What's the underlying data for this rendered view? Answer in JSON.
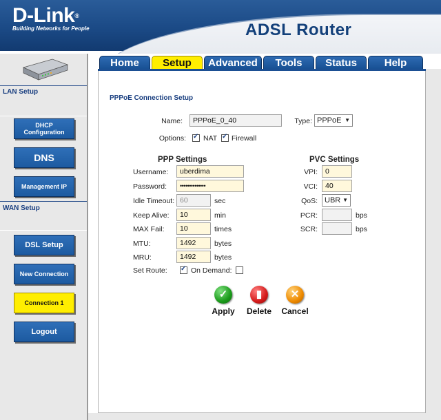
{
  "header": {
    "brand": "D-Link",
    "tagline": "Building Networks for People",
    "product": "ADSL Router"
  },
  "tabs": [
    {
      "label": "Home",
      "active": false
    },
    {
      "label": "Setup",
      "active": true
    },
    {
      "label": "Advanced",
      "active": false
    },
    {
      "label": "Tools",
      "active": false
    },
    {
      "label": "Status",
      "active": false
    },
    {
      "label": "Help",
      "active": false
    }
  ],
  "sidebar": {
    "lan_heading": "LAN Setup",
    "wan_heading": "WAN Setup",
    "buttons": {
      "dhcp": "DHCP Configuration",
      "dns": "DNS",
      "mgmt": "Management IP",
      "dsl": "DSL Setup",
      "newconn": "New Connection",
      "conn1": "Connection 1",
      "logout": "Logout"
    }
  },
  "form": {
    "title": "PPPoE Connection Setup",
    "name_label": "Name:",
    "name_value": "PPPoE_0_40",
    "type_label": "Type:",
    "type_value": "PPPoE",
    "options_label": "Options:",
    "nat_label": "NAT",
    "nat_checked": true,
    "firewall_label": "Firewall",
    "firewall_checked": true,
    "ppp": {
      "title": "PPP Settings",
      "username_label": "Username:",
      "username_value": "uberdima",
      "password_label": "Password:",
      "password_value": "••••••••••••••",
      "idle_label": "Idle Timeout:",
      "idle_value": "60",
      "idle_unit": "sec",
      "keepalive_label": "Keep Alive:",
      "keepalive_value": "10",
      "keepalive_unit": "min",
      "maxfail_label": "MAX Fail:",
      "maxfail_value": "10",
      "maxfail_unit": "times",
      "mtu_label": "MTU:",
      "mtu_value": "1492",
      "mtu_unit": "bytes",
      "mru_label": "MRU:",
      "mru_value": "1492",
      "mru_unit": "bytes",
      "setroute_label": "Set Route:",
      "setroute_checked": true,
      "ondemand_label": "On Demand:",
      "ondemand_checked": false
    },
    "pvc": {
      "title": "PVC Settings",
      "vpi_label": "VPI:",
      "vpi_value": "0",
      "vci_label": "VCI:",
      "vci_value": "40",
      "qos_label": "QoS:",
      "qos_value": "UBR",
      "pcr_label": "PCR:",
      "pcr_value": "",
      "pcr_unit": "bps",
      "scr_label": "SCR:",
      "scr_value": "",
      "scr_unit": "bps"
    }
  },
  "actions": {
    "apply": "Apply",
    "delete": "Delete",
    "cancel": "Cancel"
  },
  "colors": {
    "brand_blue": "#1b4a86",
    "active_tab": "#ffee00",
    "button_blue": "#2f6fb8"
  }
}
